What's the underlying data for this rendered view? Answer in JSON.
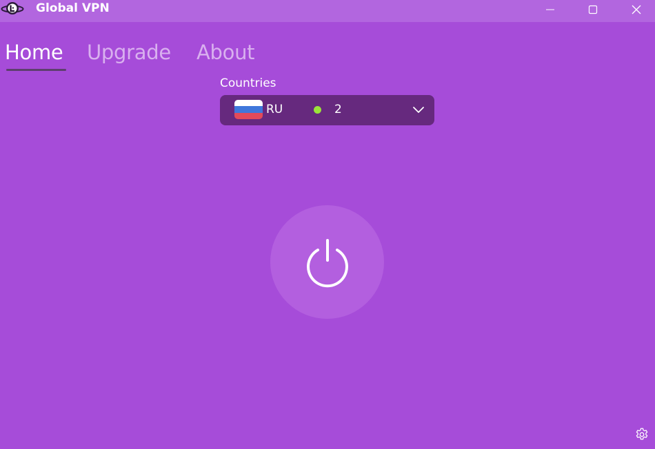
{
  "window": {
    "title": "Global VPN",
    "colors": {
      "titlebar": "#b266df",
      "background": "#a64cd9",
      "text": "#ffffff"
    }
  },
  "nav": {
    "tabs": [
      {
        "label": "Home",
        "active": true
      },
      {
        "label": "Upgrade",
        "active": false
      },
      {
        "label": "About",
        "active": false
      }
    ]
  },
  "countries": {
    "label": "Countries",
    "selected": {
      "code": "RU",
      "flag_icon": "russia-flag-icon",
      "flag_colors": [
        "#ffffff",
        "#3f77db",
        "#e24a5a"
      ],
      "status_color": "#9be33a",
      "count": "2"
    },
    "dropdown_icon": "chevron-down-icon",
    "background": "#66297e"
  },
  "power": {
    "icon": "power-icon",
    "background": "#b35fdf"
  },
  "footer": {
    "settings_icon": "gear-icon"
  }
}
